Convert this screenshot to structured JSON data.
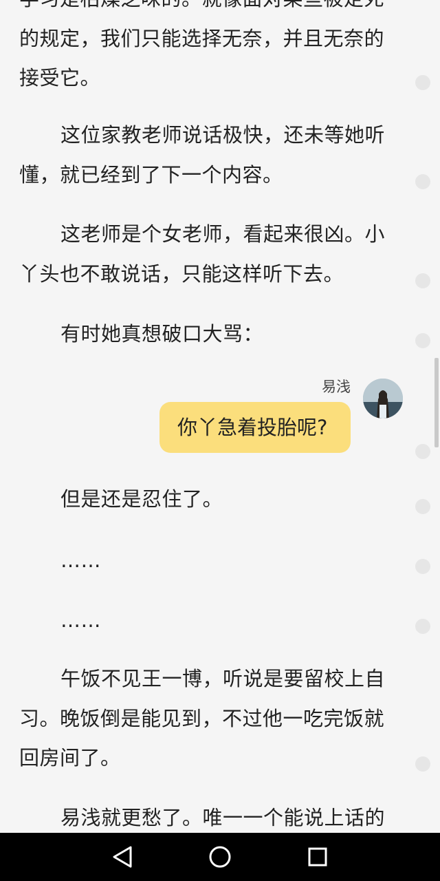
{
  "reader": {
    "paragraphs": [
      {
        "text": "学习是枯燥乏味的。就像面对某些被定死的规定，我们只能选择无奈，并且无奈的接受它。",
        "indent": false
      },
      {
        "text": "这位家教老师说话极快，还未等她听懂，就已经到了下一个内容。",
        "indent": true
      },
      {
        "text": "这老师是个女老师，看起来很凶。小丫头也不敢说话，只能这样听下去。",
        "indent": true
      },
      {
        "text": "有时她真想破口大骂：",
        "indent": true
      },
      {
        "text": "但是还是忍住了。",
        "indent": true
      },
      {
        "text": "……",
        "indent": true
      },
      {
        "text": "……",
        "indent": true
      },
      {
        "text": "午饭不见王一博，听说是要留校上自习。晚饭倒是能见到，不过他一吃完饭就回房间了。",
        "indent": true
      },
      {
        "text": "易浅就更愁了。唯一一个能说上话的",
        "indent": true
      }
    ],
    "dialog": {
      "speaker": "易浅",
      "message": "你丫急着投胎呢?"
    }
  },
  "colors": {
    "background": "#f5f5f5",
    "bubble": "#fbde7c",
    "navbar": "#000000"
  },
  "navbar": {
    "back_icon": "back-triangle-icon",
    "home_icon": "home-circle-icon",
    "recents_icon": "recents-square-icon"
  }
}
